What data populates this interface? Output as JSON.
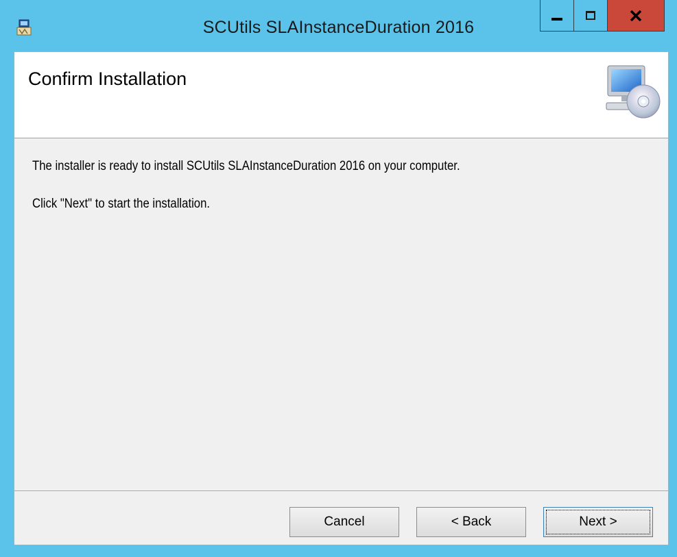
{
  "window": {
    "title": "SCUtils SLAInstanceDuration 2016",
    "app_icon": "installer-icon",
    "controls": {
      "minimize": "minimize-icon",
      "maximize": "maximize-icon",
      "close_label": "x"
    }
  },
  "banner": {
    "title": "Confirm Installation",
    "icon": "computer-cd-icon"
  },
  "content": {
    "line1": "The installer is ready to install SCUtils SLAInstanceDuration 2016 on your computer.",
    "line2": "Click \"Next\" to start the installation."
  },
  "buttons": {
    "cancel": "Cancel",
    "back": "< Back",
    "next": "Next >"
  },
  "colors": {
    "titlebar": "#5bc2ea",
    "close": "#c9483a",
    "client_bg": "#f0f0f0"
  }
}
